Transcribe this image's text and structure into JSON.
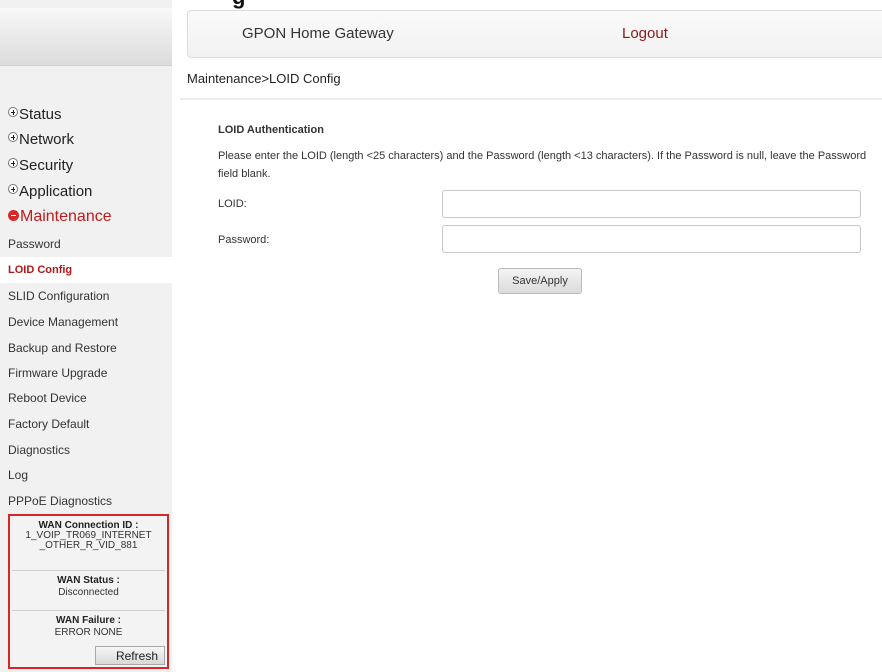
{
  "header": {
    "title": "GPON Home Gateway",
    "logout": "Logout",
    "partial_text": "g"
  },
  "breadcrumb": "Maintenance>LOID Config",
  "sidebar": {
    "groups": [
      {
        "label": "Status"
      },
      {
        "label": "Network"
      },
      {
        "label": "Security"
      },
      {
        "label": "Application"
      },
      {
        "label": "Maintenance"
      }
    ],
    "items": [
      {
        "label": "Password"
      },
      {
        "label": "LOID Config"
      },
      {
        "label": "SLID Configuration"
      },
      {
        "label": "Device Management"
      },
      {
        "label": "Backup and Restore"
      },
      {
        "label": "Firmware Upgrade"
      },
      {
        "label": "Reboot Device"
      },
      {
        "label": "Factory Default"
      },
      {
        "label": "Diagnostics"
      },
      {
        "label": "Log"
      },
      {
        "label": "PPPoE Diagnostics"
      }
    ]
  },
  "wan": {
    "connection_id_label": "WAN Connection ID :",
    "connection_id_line1": "1_VOIP_TR069_INTERNET",
    "connection_id_line2": "_OTHER_R_VID_881",
    "status_label": "WAN Status :",
    "status_value": "Disconnected",
    "failure_label": "WAN Failure :",
    "failure_value": "ERROR NONE",
    "refresh": "Refresh"
  },
  "content": {
    "section_title": "LOID Authentication",
    "instructions": "Please enter the LOID (length <25 characters) and the Password (length <13 characters). If the Password is null, leave the Password field blank.",
    "loid_label": "LOID:",
    "loid_value": "",
    "password_label": "Password:",
    "password_value": "",
    "save_button": "Save/Apply"
  }
}
